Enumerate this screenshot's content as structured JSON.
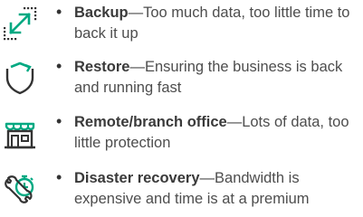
{
  "items": [
    {
      "title": "Backup",
      "sep": "—",
      "desc": "Too much data, too little time to back it up",
      "icon": "expand-arrow-icon"
    },
    {
      "title": "Restore",
      "sep": "—",
      "desc": "Ensuring the business is back and running fast",
      "icon": "shield-refresh-icon"
    },
    {
      "title": "Remote/branch office",
      "sep": "—",
      "desc": "Lots of data, too little protection",
      "icon": "storefront-icon"
    },
    {
      "title": "Disaster recovery",
      "sep": "—",
      "desc": "Bandwidth is expensive and time is at a premium",
      "icon": "wrench-stopwatch-icon"
    }
  ],
  "bullet": "•",
  "colors": {
    "accent": "#01a982",
    "text": "#4d4d4d"
  }
}
